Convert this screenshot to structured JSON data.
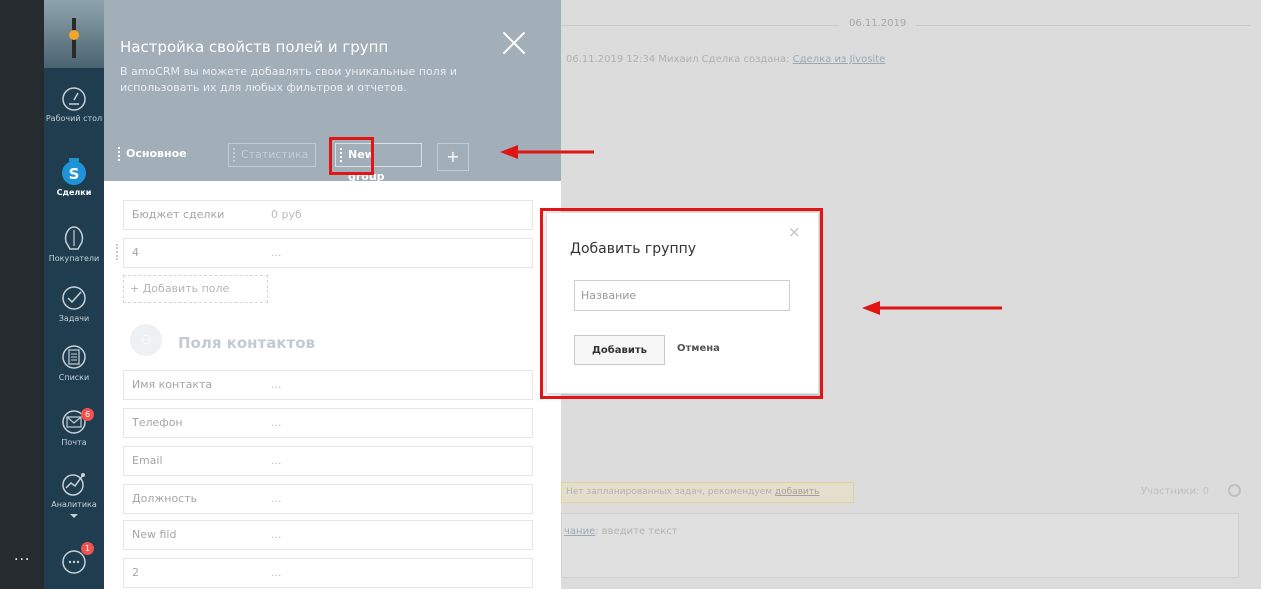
{
  "sidebar": {
    "items": [
      {
        "label": "Рабочий стол",
        "icon": "dashboard-gauge-icon"
      },
      {
        "label": "Сделки",
        "icon": "deals-dollar-icon",
        "active": true
      },
      {
        "label": "Покупатели",
        "icon": "customers-icon"
      },
      {
        "label": "Задачи",
        "icon": "tasks-check-icon"
      },
      {
        "label": "Списки",
        "icon": "lists-icon"
      },
      {
        "label": "Почта",
        "icon": "mail-icon",
        "badge": "6"
      },
      {
        "label": "Аналитика",
        "icon": "analytics-icon"
      }
    ],
    "chat_badge": "1",
    "more_label": "..."
  },
  "panel": {
    "title": "Настройка свойств полей и групп",
    "description": "В amoCRM вы можете добавлять свои уникальные поля и использовать их для любых фильтров и отчетов.",
    "tabs": [
      {
        "label": "Основное"
      },
      {
        "label": "Статистика"
      },
      {
        "label": "New group"
      }
    ],
    "add_tab_label": "+",
    "deal_fields": [
      {
        "name": "Бюджет сделки",
        "value": "0 руб"
      },
      {
        "name": "4",
        "value": "..."
      }
    ],
    "add_field_label": "+ Добавить поле",
    "contacts_title": "Поля контактов",
    "contact_fields": [
      {
        "name": "Имя контакта",
        "value": "..."
      },
      {
        "name": "Телефон",
        "value": "..."
      },
      {
        "name": "Email",
        "value": "..."
      },
      {
        "name": "Должность",
        "value": "..."
      },
      {
        "name": "New fild",
        "value": "..."
      },
      {
        "name": "2",
        "value": "..."
      }
    ]
  },
  "background": {
    "date": "06.11.2019",
    "event_prefix": "06.11.2019 12:34 Михаил  Сделка создана: ",
    "event_link": "Сделка из Jivosite",
    "tasks_prefix": "Нет запланированных задач, рекомендуем ",
    "tasks_link": "добавить",
    "members": "Участники: 0",
    "note_link": "чание",
    "note_text": ": введите текст"
  },
  "dialog": {
    "title": "Добавить группу",
    "close": "×",
    "input_placeholder": "Название",
    "add_button": "Добавить",
    "cancel_button": "Отмена"
  },
  "colors": {
    "sidebar": "#1f3d4f",
    "panel_header": "#a2aeb8",
    "highlight": "#e01515",
    "badge": "#f0524d"
  }
}
